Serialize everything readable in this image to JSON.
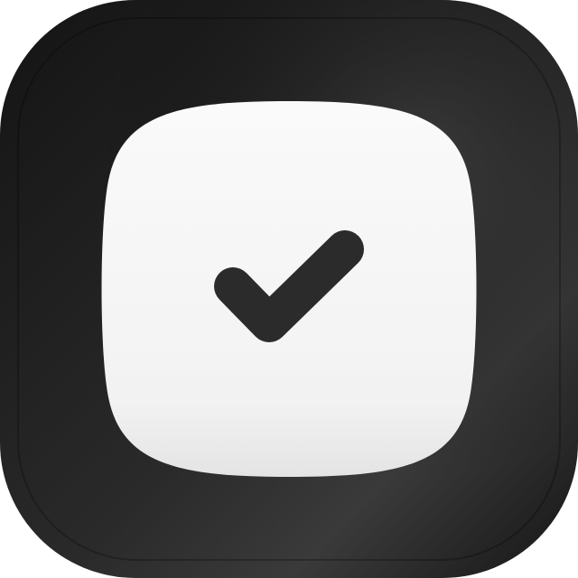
{
  "icon": {
    "name": "checkmark-app-icon",
    "outer_color": "#1c1c1c",
    "outer_highlight_color": "#3a3a3a",
    "inner_color": "#f5f5f5",
    "inner_shadow_color": "#e6e6e6",
    "check_color": "#2b2b2b",
    "glyph": "checkmark-icon"
  }
}
